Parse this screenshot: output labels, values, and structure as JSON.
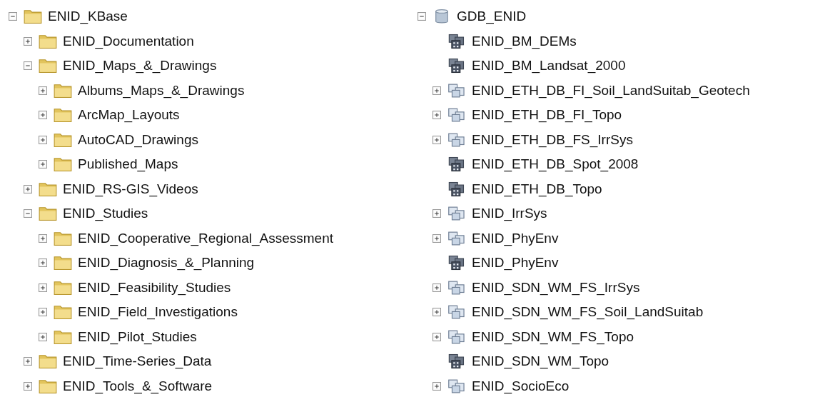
{
  "trees": [
    {
      "label": "ENID_KBase",
      "kind": "folder",
      "expanded": true,
      "children": [
        {
          "label": "ENID_Documentation",
          "kind": "folder",
          "expanded": false
        },
        {
          "label": "ENID_Maps_&_Drawings",
          "kind": "folder",
          "expanded": true,
          "children": [
            {
              "label": "Albums_Maps_&_Drawings",
              "kind": "folder",
              "expanded": false
            },
            {
              "label": "ArcMap_Layouts",
              "kind": "folder",
              "expanded": false
            },
            {
              "label": "AutoCAD_Drawings",
              "kind": "folder",
              "expanded": false
            },
            {
              "label": "Published_Maps",
              "kind": "folder",
              "expanded": false
            }
          ]
        },
        {
          "label": "ENID_RS-GIS_Videos",
          "kind": "folder",
          "expanded": false
        },
        {
          "label": "ENID_Studies",
          "kind": "folder",
          "expanded": true,
          "children": [
            {
              "label": "ENID_Cooperative_Regional_Assessment",
              "kind": "folder",
              "expanded": false
            },
            {
              "label": "ENID_Diagnosis_&_Planning",
              "kind": "folder",
              "expanded": false
            },
            {
              "label": "ENID_Feasibility_Studies",
              "kind": "folder",
              "expanded": false
            },
            {
              "label": "ENID_Field_Investigations",
              "kind": "folder",
              "expanded": false
            },
            {
              "label": "ENID_Pilot_Studies",
              "kind": "folder",
              "expanded": false
            }
          ]
        },
        {
          "label": "ENID_Time-Series_Data",
          "kind": "folder",
          "expanded": false
        },
        {
          "label": "ENID_Tools_&_Software",
          "kind": "folder",
          "expanded": false
        }
      ]
    },
    {
      "label": "GDB_ENID",
      "kind": "database",
      "expanded": true,
      "children": [
        {
          "label": "ENID_BM_DEMs",
          "kind": "raster"
        },
        {
          "label": "ENID_BM_Landsat_2000",
          "kind": "raster"
        },
        {
          "label": "ENID_ETH_DB_FI_Soil_LandSuitab_Geotech",
          "kind": "dataset",
          "expanded": false
        },
        {
          "label": "ENID_ETH_DB_FI_Topo",
          "kind": "dataset",
          "expanded": false
        },
        {
          "label": "ENID_ETH_DB_FS_IrrSys",
          "kind": "dataset",
          "expanded": false
        },
        {
          "label": "ENID_ETH_DB_Spot_2008",
          "kind": "raster"
        },
        {
          "label": "ENID_ETH_DB_Topo",
          "kind": "raster"
        },
        {
          "label": "ENID_IrrSys",
          "kind": "dataset",
          "expanded": false
        },
        {
          "label": "ENID_PhyEnv",
          "kind": "dataset",
          "expanded": false
        },
        {
          "label": "ENID_PhyEnv",
          "kind": "raster"
        },
        {
          "label": "ENID_SDN_WM_FS_IrrSys",
          "kind": "dataset",
          "expanded": false
        },
        {
          "label": "ENID_SDN_WM_FS_Soil_LandSuitab",
          "kind": "dataset",
          "expanded": false
        },
        {
          "label": "ENID_SDN_WM_FS_Topo",
          "kind": "dataset",
          "expanded": false
        },
        {
          "label": "ENID_SDN_WM_Topo",
          "kind": "raster"
        },
        {
          "label": "ENID_SocioEco",
          "kind": "dataset",
          "expanded": false
        }
      ]
    }
  ]
}
